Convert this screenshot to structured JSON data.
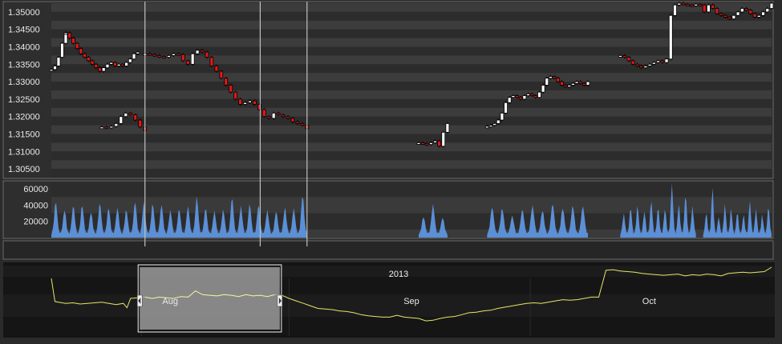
{
  "chart_data": [
    {
      "type": "candlestick",
      "panel": "price",
      "y_ticks": [
        "1.35000",
        "1.34500",
        "1.34000",
        "1.33500",
        "1.33000",
        "1.32500",
        "1.32000",
        "1.31500",
        "1.31000",
        "1.30500"
      ],
      "ylim": [
        1.3025,
        1.3525
      ],
      "xlim": [
        0,
        100
      ],
      "cursor_lines_x": [
        13.0,
        29.0,
        35.5
      ],
      "colors": {
        "up": "#ffffff",
        "down": "#e01818",
        "wick": "#000000",
        "band_a": "#3c3c3c",
        "band_b": "#2c2c2c",
        "cursor": "#c0c0c0"
      },
      "segments": [
        {
          "x_start": 0.0,
          "x_end": 2.0,
          "closes": [
            1.3335,
            1.3345,
            1.337,
            1.341,
            1.344
          ]
        },
        {
          "x_start": 2.0,
          "x_end": 12.0,
          "closes": [
            1.344,
            1.3425,
            1.341,
            1.3395,
            1.338,
            1.337,
            1.336,
            1.335,
            1.334,
            1.333,
            1.334,
            1.335,
            1.3355,
            1.3345,
            1.335,
            1.3345,
            1.3355,
            1.3365,
            1.338,
            1.3385
          ]
        },
        {
          "x_start": 7.0,
          "x_end": 13.0,
          "closes": [
            1.317,
            1.3168,
            1.3172,
            1.318,
            1.32,
            1.321,
            1.3205,
            1.319,
            1.317,
            1.316
          ]
        },
        {
          "x_start": 13.0,
          "x_end": 35.5,
          "closes": [
            1.338,
            1.3378,
            1.3375,
            1.3372,
            1.337,
            1.3375,
            1.338,
            1.3378,
            1.336,
            1.335,
            1.338,
            1.339,
            1.3385,
            1.337,
            1.3345,
            1.333,
            1.331,
            1.329,
            1.327,
            1.325,
            1.3235,
            1.324,
            1.3245,
            1.3235,
            1.322,
            1.32,
            1.3195,
            1.321,
            1.3205,
            1.32,
            1.3195,
            1.3185,
            1.318,
            1.3175,
            1.3165
          ]
        },
        {
          "x_start": 51.0,
          "x_end": 55.0,
          "closes": [
            1.3125,
            1.3123,
            1.312,
            1.3125,
            1.313,
            1.3115,
            1.3155,
            1.318
          ]
        },
        {
          "x_start": 60.5,
          "x_end": 74.5,
          "closes": [
            1.3172,
            1.3175,
            1.318,
            1.319,
            1.321,
            1.324,
            1.3255,
            1.326,
            1.3255,
            1.325,
            1.326,
            1.3265,
            1.326,
            1.3255,
            1.327,
            1.329,
            1.331,
            1.3315,
            1.331,
            1.33,
            1.329,
            1.3285,
            1.329,
            1.3295,
            1.33,
            1.3295,
            1.329,
            1.33
          ]
        },
        {
          "x_start": 79.0,
          "x_end": 100.0,
          "closes": [
            1.3375,
            1.337,
            1.336,
            1.335,
            1.3345,
            1.334,
            1.3345,
            1.335,
            1.3355,
            1.336,
            1.3355,
            1.3365,
            1.349,
            1.352,
            1.3525,
            1.3522,
            1.352,
            1.3518,
            1.3522,
            1.352,
            1.35,
            1.352,
            1.351,
            1.3495,
            1.349,
            1.3485,
            1.348,
            1.349,
            1.35,
            1.351,
            1.3505,
            1.3495,
            1.3485,
            1.349,
            1.35,
            1.351,
            1.3525
          ]
        }
      ]
    },
    {
      "type": "area",
      "panel": "volume",
      "y_ticks": [
        "60000",
        "40000",
        "20000"
      ],
      "ylim": [
        0,
        68000
      ],
      "color": "#5b8fd6",
      "segments": [
        {
          "x_start": 0.0,
          "x_end": 35.5,
          "peaks": [
            40000,
            30000,
            35000,
            36000,
            27000,
            38000,
            33000,
            32000,
            30000,
            40000,
            39000,
            38000,
            36000,
            29000,
            31000,
            34000,
            46000,
            32000,
            28000,
            30000,
            45000,
            34000,
            37000,
            36000,
            29000,
            28000,
            33000,
            31000,
            48000
          ]
        },
        {
          "x_start": 51.0,
          "x_end": 55.0,
          "peaks": [
            21000,
            36000,
            20000
          ]
        },
        {
          "x_start": 60.5,
          "x_end": 74.5,
          "peaks": [
            33000,
            32000,
            22000,
            30000,
            35000,
            29000,
            37000,
            32000,
            35000,
            34000
          ]
        },
        {
          "x_start": 79.0,
          "x_end": 89.5,
          "peaks": [
            25000,
            33000,
            35000,
            28000,
            42000,
            33000,
            32000,
            62000,
            37000,
            49000,
            34000
          ]
        },
        {
          "x_start": 90.5,
          "x_end": 100.0,
          "peaks": [
            27000,
            58000,
            22000,
            37000,
            32000,
            28000,
            24000,
            42000,
            31000,
            24000,
            35000
          ]
        }
      ]
    },
    {
      "type": "line",
      "panel": "navigator",
      "title": "2013",
      "month_labels": [
        "Aug",
        "Sep",
        "Oct"
      ],
      "ylim": [
        0,
        1
      ],
      "color": "#e6e66a",
      "selection": {
        "from": 12.5,
        "to": 31.5
      },
      "x": [
        0,
        0.5,
        1,
        2,
        3,
        4,
        5,
        6,
        7,
        8,
        9,
        10,
        10.5,
        11,
        12,
        13,
        14,
        15,
        16,
        17,
        18,
        19,
        20,
        21,
        22,
        23,
        24,
        25,
        26,
        27,
        28,
        29,
        30,
        31,
        32,
        33,
        34,
        35,
        36,
        37,
        38,
        39,
        40,
        41,
        42,
        43,
        44,
        45,
        46,
        47,
        48,
        49,
        50,
        51,
        52,
        53,
        54,
        55,
        56,
        57,
        58,
        59,
        60,
        61,
        62,
        63,
        64,
        65,
        66,
        67,
        68,
        69,
        70,
        71,
        72,
        73,
        74,
        75,
        76,
        77,
        78,
        79,
        80,
        81,
        82,
        83,
        84,
        85,
        86,
        87,
        88,
        89,
        90,
        91,
        92,
        93,
        94,
        95,
        96,
        97,
        98,
        99,
        100
      ],
      "y": [
        0.82,
        0.45,
        0.44,
        0.42,
        0.43,
        0.41,
        0.42,
        0.43,
        0.44,
        0.42,
        0.4,
        0.42,
        0.35,
        0.5,
        0.51,
        0.52,
        0.5,
        0.52,
        0.51,
        0.5,
        0.53,
        0.52,
        0.62,
        0.56,
        0.55,
        0.54,
        0.56,
        0.55,
        0.53,
        0.56,
        0.54,
        0.55,
        0.53,
        0.56,
        0.55,
        0.5,
        0.46,
        0.42,
        0.38,
        0.34,
        0.33,
        0.32,
        0.3,
        0.29,
        0.27,
        0.24,
        0.22,
        0.21,
        0.2,
        0.2,
        0.23,
        0.2,
        0.19,
        0.18,
        0.14,
        0.15,
        0.18,
        0.2,
        0.21,
        0.24,
        0.27,
        0.28,
        0.3,
        0.31,
        0.34,
        0.36,
        0.38,
        0.4,
        0.42,
        0.43,
        0.42,
        0.44,
        0.46,
        0.48,
        0.47,
        0.48,
        0.5,
        0.52,
        0.52,
        0.95,
        0.96,
        0.94,
        0.93,
        0.92,
        0.9,
        0.89,
        0.88,
        0.87,
        0.88,
        0.89,
        0.86,
        0.88,
        0.87,
        0.89,
        0.88,
        0.86,
        0.9,
        0.91,
        0.92,
        0.91,
        0.92,
        0.93,
        1.0
      ]
    }
  ]
}
